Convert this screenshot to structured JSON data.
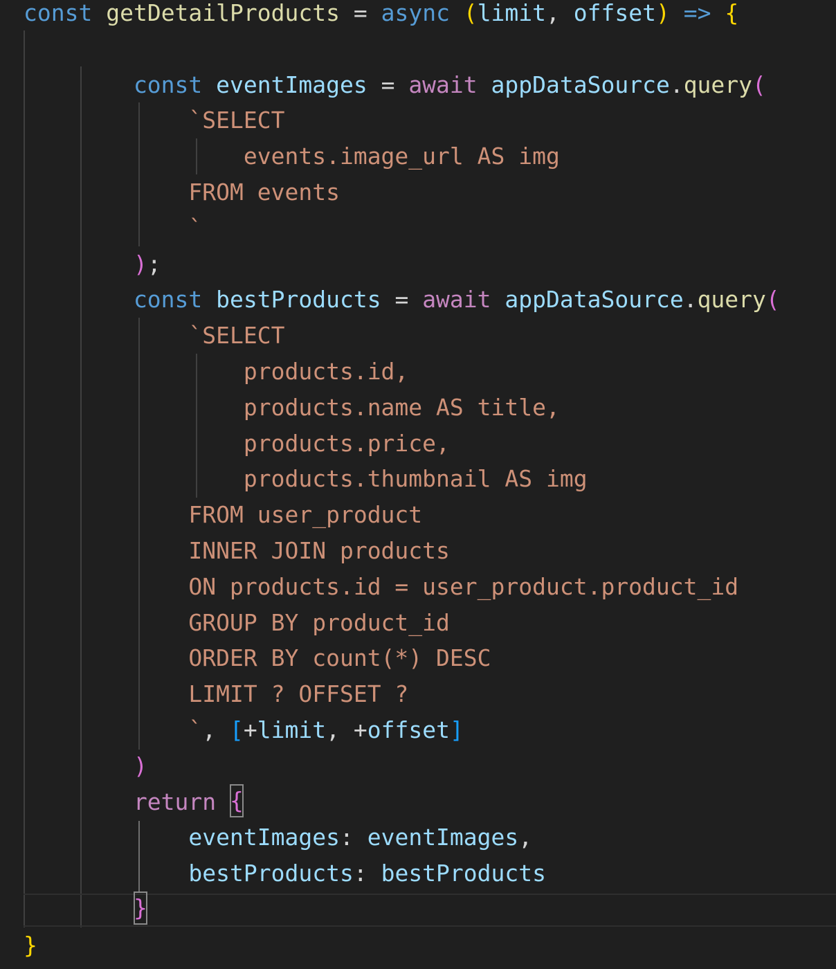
{
  "editor": {
    "lines": [
      {
        "tokens": [
          {
            "text": "const",
            "cls": "t-kw"
          },
          {
            "text": " ",
            "cls": "t-plain"
          },
          {
            "text": "getDetailProducts",
            "cls": "t-fn"
          },
          {
            "text": " = ",
            "cls": "t-op"
          },
          {
            "text": "async",
            "cls": "t-kw"
          },
          {
            "text": " ",
            "cls": "t-plain"
          },
          {
            "text": "(",
            "cls": "t-b1"
          },
          {
            "text": "limit",
            "cls": "t-var"
          },
          {
            "text": ", ",
            "cls": "t-op"
          },
          {
            "text": "offset",
            "cls": "t-var"
          },
          {
            "text": ")",
            "cls": "t-b1"
          },
          {
            "text": " ",
            "cls": "t-plain"
          },
          {
            "text": "=>",
            "cls": "t-kw"
          },
          {
            "text": " ",
            "cls": "t-plain"
          },
          {
            "text": "{",
            "cls": "t-b1"
          }
        ]
      },
      {
        "tokens": []
      },
      {
        "tokens": [
          {
            "text": "        const",
            "cls": "t-kw"
          },
          {
            "text": " ",
            "cls": "t-plain"
          },
          {
            "text": "eventImages",
            "cls": "t-var"
          },
          {
            "text": " = ",
            "cls": "t-op"
          },
          {
            "text": "await",
            "cls": "t-await"
          },
          {
            "text": " ",
            "cls": "t-plain"
          },
          {
            "text": "appDataSource",
            "cls": "t-var"
          },
          {
            "text": ".",
            "cls": "t-op"
          },
          {
            "text": "query",
            "cls": "t-fn"
          },
          {
            "text": "(",
            "cls": "t-b2"
          }
        ]
      },
      {
        "tokens": [
          {
            "text": "            `SELECT",
            "cls": "t-str"
          }
        ]
      },
      {
        "tokens": [
          {
            "text": "                events.image_url AS img",
            "cls": "t-str"
          }
        ]
      },
      {
        "tokens": [
          {
            "text": "            FROM events",
            "cls": "t-str"
          }
        ]
      },
      {
        "tokens": [
          {
            "text": "            `",
            "cls": "t-str"
          }
        ]
      },
      {
        "tokens": [
          {
            "text": "        )",
            "cls": "t-b2"
          },
          {
            "text": ";",
            "cls": "t-op"
          }
        ]
      },
      {
        "tokens": [
          {
            "text": "        const",
            "cls": "t-kw"
          },
          {
            "text": " ",
            "cls": "t-plain"
          },
          {
            "text": "bestProducts",
            "cls": "t-var"
          },
          {
            "text": " = ",
            "cls": "t-op"
          },
          {
            "text": "await",
            "cls": "t-await"
          },
          {
            "text": " ",
            "cls": "t-plain"
          },
          {
            "text": "appDataSource",
            "cls": "t-var"
          },
          {
            "text": ".",
            "cls": "t-op"
          },
          {
            "text": "query",
            "cls": "t-fn"
          },
          {
            "text": "(",
            "cls": "t-b2"
          }
        ]
      },
      {
        "tokens": [
          {
            "text": "            `SELECT",
            "cls": "t-str"
          }
        ]
      },
      {
        "tokens": [
          {
            "text": "                products.id,",
            "cls": "t-str"
          }
        ]
      },
      {
        "tokens": [
          {
            "text": "                products.name AS title,",
            "cls": "t-str"
          }
        ]
      },
      {
        "tokens": [
          {
            "text": "                products.price,",
            "cls": "t-str"
          }
        ]
      },
      {
        "tokens": [
          {
            "text": "                products.thumbnail AS img",
            "cls": "t-str"
          }
        ]
      },
      {
        "tokens": [
          {
            "text": "            FROM user_product",
            "cls": "t-str"
          }
        ]
      },
      {
        "tokens": [
          {
            "text": "            INNER JOIN products",
            "cls": "t-str"
          }
        ]
      },
      {
        "tokens": [
          {
            "text": "            ON products.id = user_product.product_id",
            "cls": "t-str"
          }
        ]
      },
      {
        "tokens": [
          {
            "text": "            GROUP BY product_id",
            "cls": "t-str"
          }
        ]
      },
      {
        "tokens": [
          {
            "text": "            ORDER BY count(*) DESC",
            "cls": "t-str"
          }
        ]
      },
      {
        "tokens": [
          {
            "text": "            LIMIT ? OFFSET ?",
            "cls": "t-str"
          }
        ]
      },
      {
        "tokens": [
          {
            "text": "            `",
            "cls": "t-str"
          },
          {
            "text": ", ",
            "cls": "t-op"
          },
          {
            "text": "[",
            "cls": "t-b3"
          },
          {
            "text": "+",
            "cls": "t-op"
          },
          {
            "text": "limit",
            "cls": "t-var"
          },
          {
            "text": ", ",
            "cls": "t-op"
          },
          {
            "text": "+",
            "cls": "t-op"
          },
          {
            "text": "offset",
            "cls": "t-var"
          },
          {
            "text": "]",
            "cls": "t-b3"
          }
        ]
      },
      {
        "tokens": [
          {
            "text": "        )",
            "cls": "t-b2"
          }
        ]
      },
      {
        "tokens": [
          {
            "text": "        return",
            "cls": "t-await"
          },
          {
            "text": " ",
            "cls": "t-plain"
          },
          {
            "text": "{",
            "cls": "t-b2",
            "box": true
          }
        ]
      },
      {
        "tokens": [
          {
            "text": "            eventImages",
            "cls": "t-var"
          },
          {
            "text": ": ",
            "cls": "t-op"
          },
          {
            "text": "eventImages",
            "cls": "t-var"
          },
          {
            "text": ",",
            "cls": "t-op"
          }
        ]
      },
      {
        "tokens": [
          {
            "text": "            bestProducts",
            "cls": "t-var"
          },
          {
            "text": ": ",
            "cls": "t-op"
          },
          {
            "text": "bestProducts",
            "cls": "t-var"
          }
        ]
      },
      {
        "tokens": [
          {
            "text": "        }",
            "cls": "t-b2",
            "box": true
          }
        ]
      },
      {
        "tokens": [
          {
            "text": "}",
            "cls": "t-b1"
          }
        ]
      }
    ]
  }
}
